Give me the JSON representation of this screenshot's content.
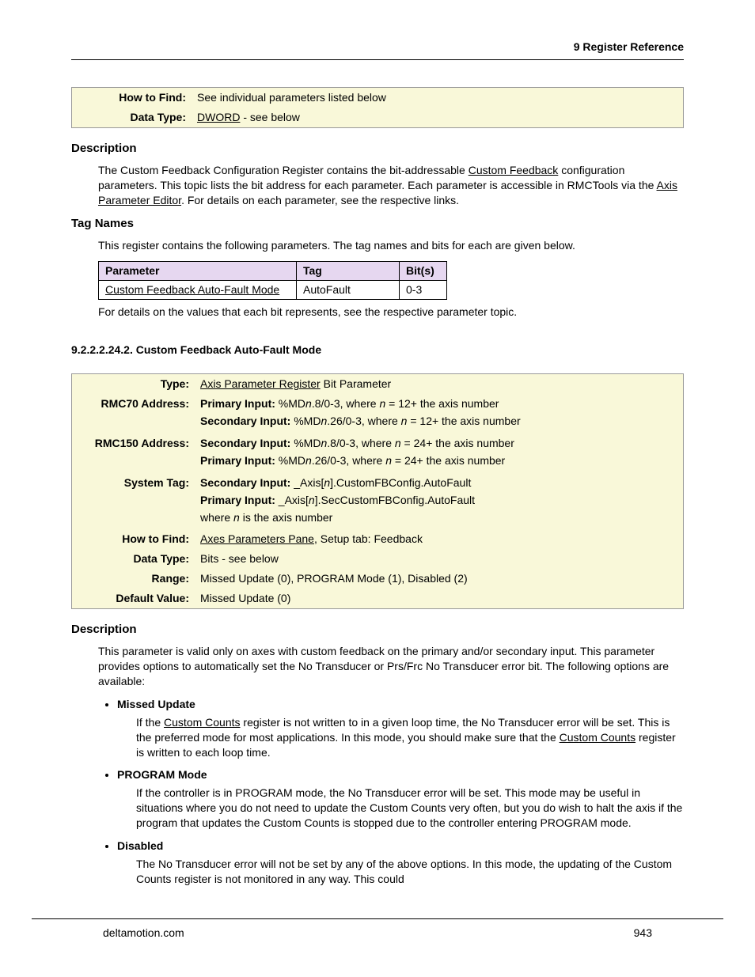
{
  "running_head": "9  Register Reference",
  "box1": {
    "rows": [
      {
        "label": "How to Find:",
        "value_plain": "See individual parameters listed below"
      },
      {
        "label": "Data Type:",
        "value_link": "DWORD",
        "value_after": " - see below"
      }
    ]
  },
  "sec1": {
    "h_desc": "Description",
    "desc_pre": "The Custom Feedback Configuration Register contains the bit-addressable ",
    "desc_link1": "Custom Feedback",
    "desc_mid": " configuration parameters. This topic lists the bit address for each parameter. Each parameter is accessible in RMCTools via the ",
    "desc_link2": "Axis Parameter Editor",
    "desc_post": ". For details on each parameter, see the respective links.",
    "h_tags": "Tag Names",
    "tags_intro": "This register contains the following parameters. The tag names and bits for each are given below.",
    "table": {
      "headers": [
        "Parameter",
        "Tag",
        "Bit(s)"
      ],
      "row": {
        "param": "Custom Feedback Auto-Fault Mode",
        "tag": "AutoFault",
        "bits": "0-3"
      }
    },
    "tags_note": "For details on the values that each bit represents, see the respective parameter topic."
  },
  "sec2": {
    "number_title": "9.2.2.2.24.2. Custom Feedback Auto-Fault Mode",
    "box": {
      "type_label": "Type:",
      "type_link": "Axis Parameter Register",
      "type_after": " Bit Parameter",
      "rmc70_label": "RMC70 Address:",
      "rmc70_l1_b": "Primary Input: ",
      "rmc70_l1_a": "%MD",
      "rmc70_l1_n": "n",
      "rmc70_l1_c": ".8/0-3, where ",
      "rmc70_l1_n2": "n",
      "rmc70_l1_d": " = 12+ the axis number",
      "rmc70_l2_b": "Secondary Input: ",
      "rmc70_l2_a": "%MD",
      "rmc70_l2_n": "n",
      "rmc70_l2_c": ".26/0-3, where ",
      "rmc70_l2_n2": "n",
      "rmc70_l2_d": " = 12+ the axis number",
      "rmc150_label": "RMC150 Address:",
      "rmc150_l1_b": "Secondary Input: ",
      "rmc150_l1_a": "%MD",
      "rmc150_l1_n": "n",
      "rmc150_l1_c": ".8/0-3, where ",
      "rmc150_l1_n2": "n",
      "rmc150_l1_d": " = 24+ the axis number",
      "rmc150_l2_b": "Primary Input: ",
      "rmc150_l2_a": "%MD",
      "rmc150_l2_n": "n",
      "rmc150_l2_c": ".26/0-3, where ",
      "rmc150_l2_n2": "n",
      "rmc150_l2_d": " = 24+ the axis number",
      "systag_label": "System Tag:",
      "systag_l1_b": "Secondary Input: ",
      "systag_l1_v": "_Axis[",
      "systag_l1_n": "n",
      "systag_l1_w": "].CustomFBConfig.AutoFault",
      "systag_l2_b": "Primary Input: ",
      "systag_l2_v": "_Axis[",
      "systag_l2_n": "n",
      "systag_l2_w": "].SecCustomFBConfig.AutoFault",
      "systag_l3_a": "where ",
      "systag_l3_n": "n",
      "systag_l3_b": " is the axis number",
      "howto_label": "How to Find:",
      "howto_link": "Axes Parameters Pane",
      "howto_after": ", Setup tab: Feedback",
      "dtype_label": "Data Type:",
      "dtype_value": "Bits - see below",
      "range_label": "Range:",
      "range_value": "Missed Update (0), PROGRAM Mode (1), Disabled (2)",
      "default_label": "Default Value:",
      "default_value": "Missed Update (0)"
    },
    "h_desc": "Description",
    "desc_text": "This parameter is valid only on axes with custom feedback on the primary and/or secondary input. This parameter provides options to automatically set the No Transducer or Prs/Frc No Transducer error bit. The following options are available:",
    "options": [
      {
        "title": "Missed Update",
        "pre": "If the ",
        "link1": "Custom Counts",
        "mid": " register is not written to in a given loop time, the No Transducer error will be set. This is the preferred mode for most applications. In this mode, you should make sure that the ",
        "link2": "Custom Counts",
        "post": " register is written to each loop time."
      },
      {
        "title": "PROGRAM Mode",
        "body": "If the controller is in PROGRAM mode, the No Transducer error will be set. This mode may be useful in situations where you do not need to update the Custom Counts very often, but you do wish to halt the axis if the program that updates the Custom Counts is stopped due to the controller entering PROGRAM mode."
      },
      {
        "title": "Disabled",
        "body": "The No Transducer error will not be set by any of the above options. In this mode, the updating of the Custom Counts register is not monitored in any way. This could"
      }
    ]
  },
  "footer": {
    "left": "deltamotion.com",
    "right": "943"
  }
}
